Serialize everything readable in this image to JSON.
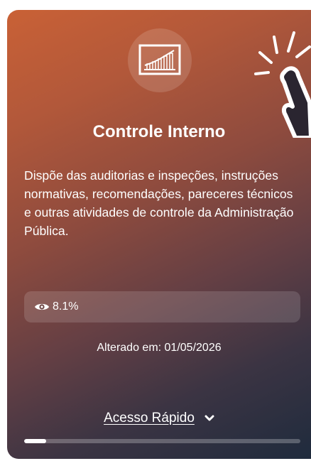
{
  "card": {
    "icon": "growth-chart-icon",
    "title": "Controle Interno",
    "description": "Dispõe das auditorias e inspeções, instruções normativas, recomendações, pareceres técnicos e outras atividades de controle da Administração Pública.",
    "views_icon": "eye-icon",
    "views": "8.1%",
    "altered": "Alterado em: 01/05/2026",
    "access_label": "Acesso Rápido",
    "access_icon": "chevron-down-icon",
    "progress_fraction": 0.08
  },
  "colors": {
    "gradient_start": "#c96136",
    "gradient_end": "#1f2b3d",
    "text": "#ffffff"
  },
  "decoration": {
    "cursor_icon": "hand-pointer-click-icon"
  }
}
